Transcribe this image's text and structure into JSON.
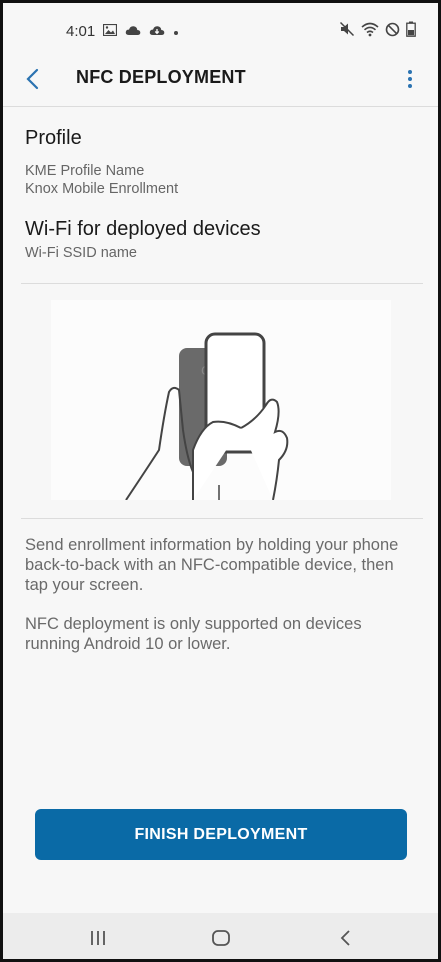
{
  "status_bar": {
    "time": "4:01",
    "left_icons": [
      "image-icon",
      "cloud-icon",
      "cloud-download-icon",
      "dot-icon"
    ],
    "right_icons": [
      "mute-icon",
      "wifi-icon",
      "do-not-disturb-icon",
      "battery-icon"
    ]
  },
  "app_bar": {
    "title": "NFC DEPLOYMENT",
    "back_icon": "chevron-left-icon",
    "menu_icon": "more-vert-icon"
  },
  "profile": {
    "heading": "Profile",
    "name": "KME Profile Name",
    "type": "Knox Mobile Enrollment"
  },
  "wifi": {
    "heading": "Wi-Fi for deployed devices",
    "ssid": "Wi-Fi SSID name"
  },
  "instructions": {
    "text1": "Send enrollment information by holding your phone back-to-back with an NFC-compatible device, then tap your screen.",
    "text2": "NFC deployment is only supported on devices running Android 10 or lower."
  },
  "actions": {
    "finish_label": "FINISH DEPLOYMENT"
  },
  "nav_bar": {
    "recents_icon": "recents-icon",
    "home_icon": "home-icon",
    "back_icon": "back-icon"
  },
  "colors": {
    "accent": "#0a6aa6",
    "link": "#2b73b1",
    "background": "#f7f7f7"
  }
}
